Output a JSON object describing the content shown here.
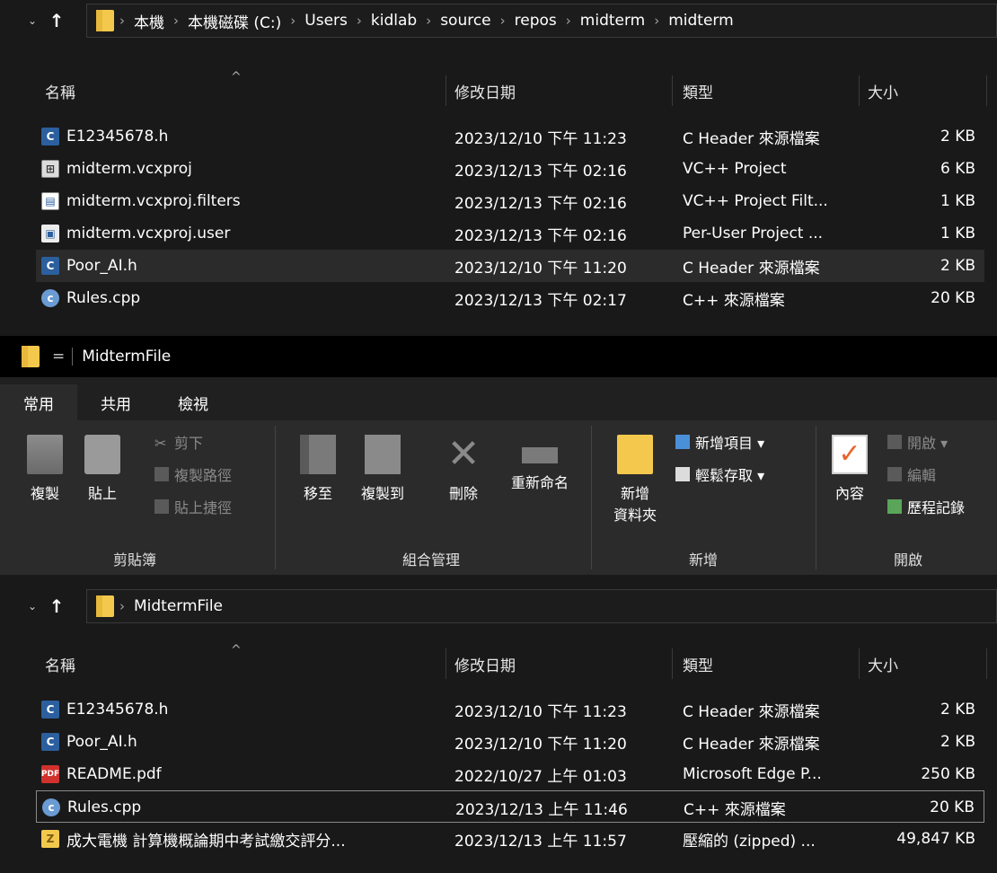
{
  "top_window": {
    "address": {
      "nav_back_chevron": "⌄",
      "nav_up": "↑",
      "crumbs": [
        "本機",
        "本機磁碟 (C:)",
        "Users",
        "kidlab",
        "source",
        "repos",
        "midterm",
        "midterm"
      ],
      "separator": "›"
    },
    "columns": {
      "name": "名稱",
      "date": "修改日期",
      "type": "類型",
      "size": "大小",
      "sort_caret": "^"
    },
    "files": [
      {
        "name": "E12345678.h",
        "date": "2023/12/10 下午 11:23",
        "type": "C Header 來源檔案",
        "size": "2 KB",
        "icon": "c-header-icon",
        "glyph": "C"
      },
      {
        "name": "midterm.vcxproj",
        "date": "2023/12/13 下午 02:16",
        "type": "VC++ Project",
        "size": "6 KB",
        "icon": "vcxproj-icon",
        "glyph": "⊞"
      },
      {
        "name": "midterm.vcxproj.filters",
        "date": "2023/12/13 下午 02:16",
        "type": "VC++ Project Filt...",
        "size": "1 KB",
        "icon": "vcxproj-filters-icon",
        "glyph": "▤"
      },
      {
        "name": "midterm.vcxproj.user",
        "date": "2023/12/13 下午 02:16",
        "type": "Per-User Project ...",
        "size": "1 KB",
        "icon": "vcxproj-user-icon",
        "glyph": "▣"
      },
      {
        "name": "Poor_AI.h",
        "date": "2023/12/10 下午 11:20",
        "type": "C Header 來源檔案",
        "size": "2 KB",
        "icon": "c-header-icon",
        "glyph": "C"
      },
      {
        "name": "Rules.cpp",
        "date": "2023/12/13 下午 02:17",
        "type": "C++ 來源檔案",
        "size": "20 KB",
        "icon": "cpp-source-icon",
        "glyph": "c"
      }
    ]
  },
  "bottom_window": {
    "title": "MidtermFile",
    "quick_access_arrow": "=",
    "ribbon_tabs": [
      "常用",
      "共用",
      "檢視"
    ],
    "ribbon": {
      "clipboard": {
        "group": "剪貼簿",
        "copy": "複製",
        "paste": "貼上",
        "cut": "剪下",
        "copy_path": "複製路徑",
        "paste_shortcut": "貼上捷徑"
      },
      "organize": {
        "group": "組合管理",
        "move_to": "移至",
        "copy_to": "複製到",
        "delete": "刪除",
        "rename": "重新命名"
      },
      "new": {
        "group": "新增",
        "new_folder_line1": "新增",
        "new_folder_line2": "資料夾",
        "new_item": "新增項目 ▾",
        "easy_access": "輕鬆存取 ▾"
      },
      "open": {
        "group": "開啟",
        "properties": "內容",
        "open": "開啟 ▾",
        "edit": "編輯",
        "history": "歷程記錄"
      }
    },
    "address": {
      "crumbs": [
        "MidtermFile"
      ],
      "separator": "›",
      "nav_back_chevron": "⌄",
      "nav_up": "↑"
    },
    "columns": {
      "name": "名稱",
      "date": "修改日期",
      "type": "類型",
      "size": "大小",
      "sort_caret": "^"
    },
    "files": [
      {
        "name": "E12345678.h",
        "date": "2023/12/10 下午 11:23",
        "type": "C Header 來源檔案",
        "size": "2 KB",
        "icon": "c-header-icon",
        "glyph": "C"
      },
      {
        "name": "Poor_AI.h",
        "date": "2023/12/10 下午 11:20",
        "type": "C Header 來源檔案",
        "size": "2 KB",
        "icon": "c-header-icon",
        "glyph": "C"
      },
      {
        "name": "README.pdf",
        "date": "2022/10/27 上午 01:03",
        "type": "Microsoft Edge P...",
        "size": "250 KB",
        "icon": "pdf-icon",
        "glyph": "PDF"
      },
      {
        "name": "Rules.cpp",
        "date": "2023/12/13 上午 11:46",
        "type": "C++ 來源檔案",
        "size": "20 KB",
        "icon": "cpp-source-icon",
        "glyph": "c"
      },
      {
        "name": "成大電機 計算機概論期中考試繳交評分...",
        "date": "2023/12/13 上午 11:57",
        "type": "壓縮的 (zipped) ...",
        "size": "49,847 KB",
        "icon": "zip-icon",
        "glyph": "Z"
      }
    ]
  }
}
